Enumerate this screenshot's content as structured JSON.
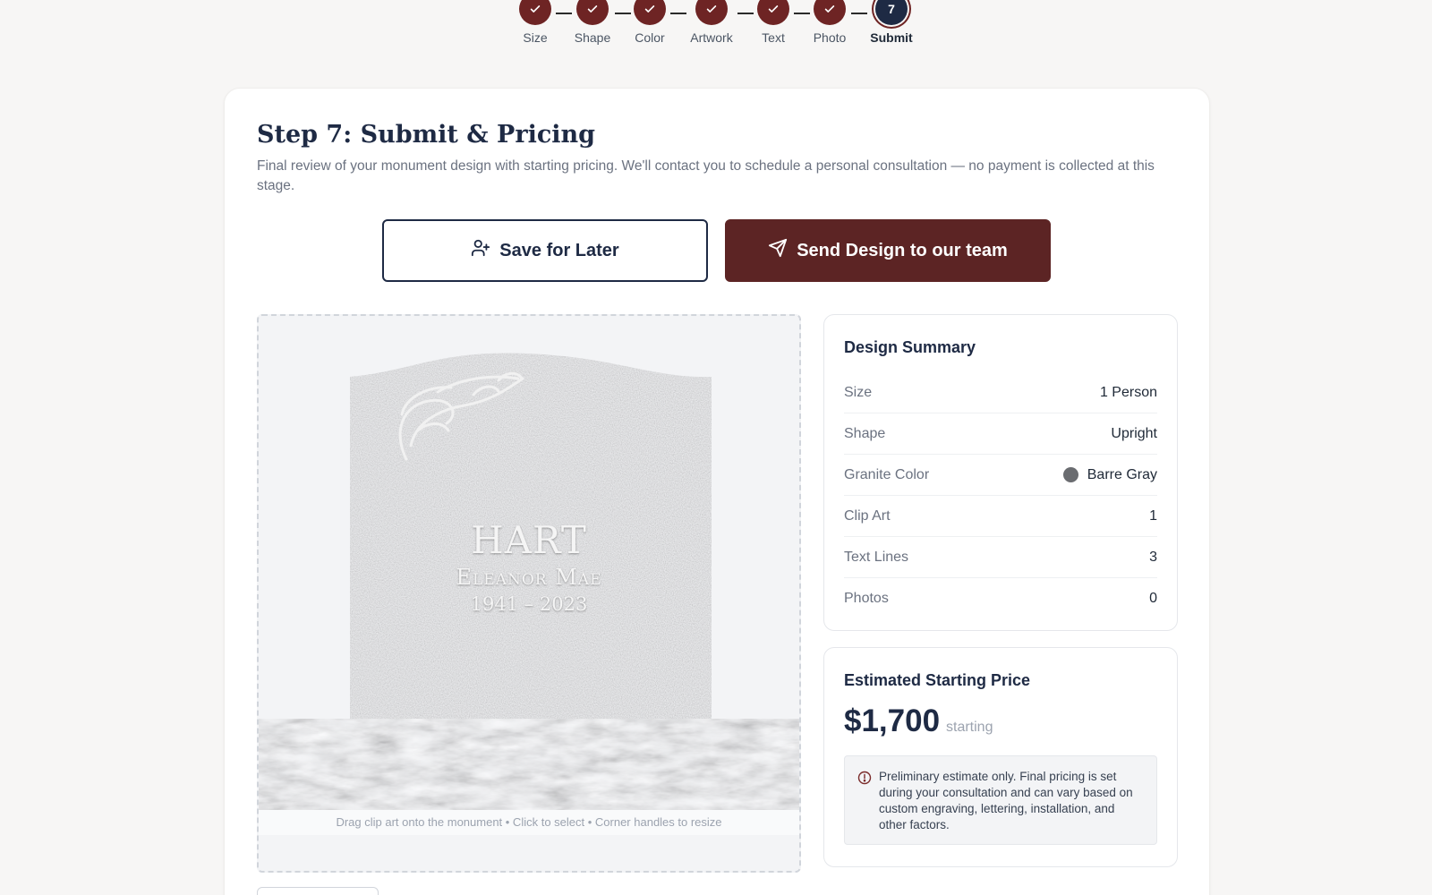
{
  "stepper": {
    "steps": [
      {
        "label": "Size",
        "state": "done"
      },
      {
        "label": "Shape",
        "state": "done"
      },
      {
        "label": "Color",
        "state": "done"
      },
      {
        "label": "Artwork",
        "state": "done"
      },
      {
        "label": "Text",
        "state": "done"
      },
      {
        "label": "Photo",
        "state": "done"
      },
      {
        "label": "Submit",
        "state": "current",
        "number": "7"
      }
    ]
  },
  "page": {
    "title": "Step 7: Submit & Pricing",
    "subtitle": "Final review of your monument design with starting pricing. We'll contact you to schedule a personal consultation — no payment is collected at this stage."
  },
  "actions": {
    "save_label": "Save for Later",
    "send_label": "Send Design to our team"
  },
  "monument": {
    "last_name": "HART",
    "first_name": "Eleanor Mae",
    "dates": "1941 – 2023",
    "hint": "Drag clip art onto the monument • Click to select • Corner handles to resize",
    "granite_color": "#8e8f91"
  },
  "summary": {
    "title": "Design Summary",
    "rows": [
      {
        "key": "Size",
        "value": "1 Person"
      },
      {
        "key": "Shape",
        "value": "Upright"
      },
      {
        "key": "Granite Color",
        "value": "Barre Gray",
        "swatch": "#6a6c70"
      },
      {
        "key": "Clip Art",
        "value": "1"
      },
      {
        "key": "Text Lines",
        "value": "3"
      },
      {
        "key": "Photos",
        "value": "0"
      }
    ]
  },
  "pricing": {
    "title": "Estimated Starting Price",
    "amount": "$1,700",
    "suffix": "starting",
    "note": "Preliminary estimate only. Final pricing is set during your consultation and can vary based on custom engraving, lettering, installation, and other factors."
  },
  "colors": {
    "brand_maroon": "#5c2424",
    "navy": "#1e2a44"
  }
}
